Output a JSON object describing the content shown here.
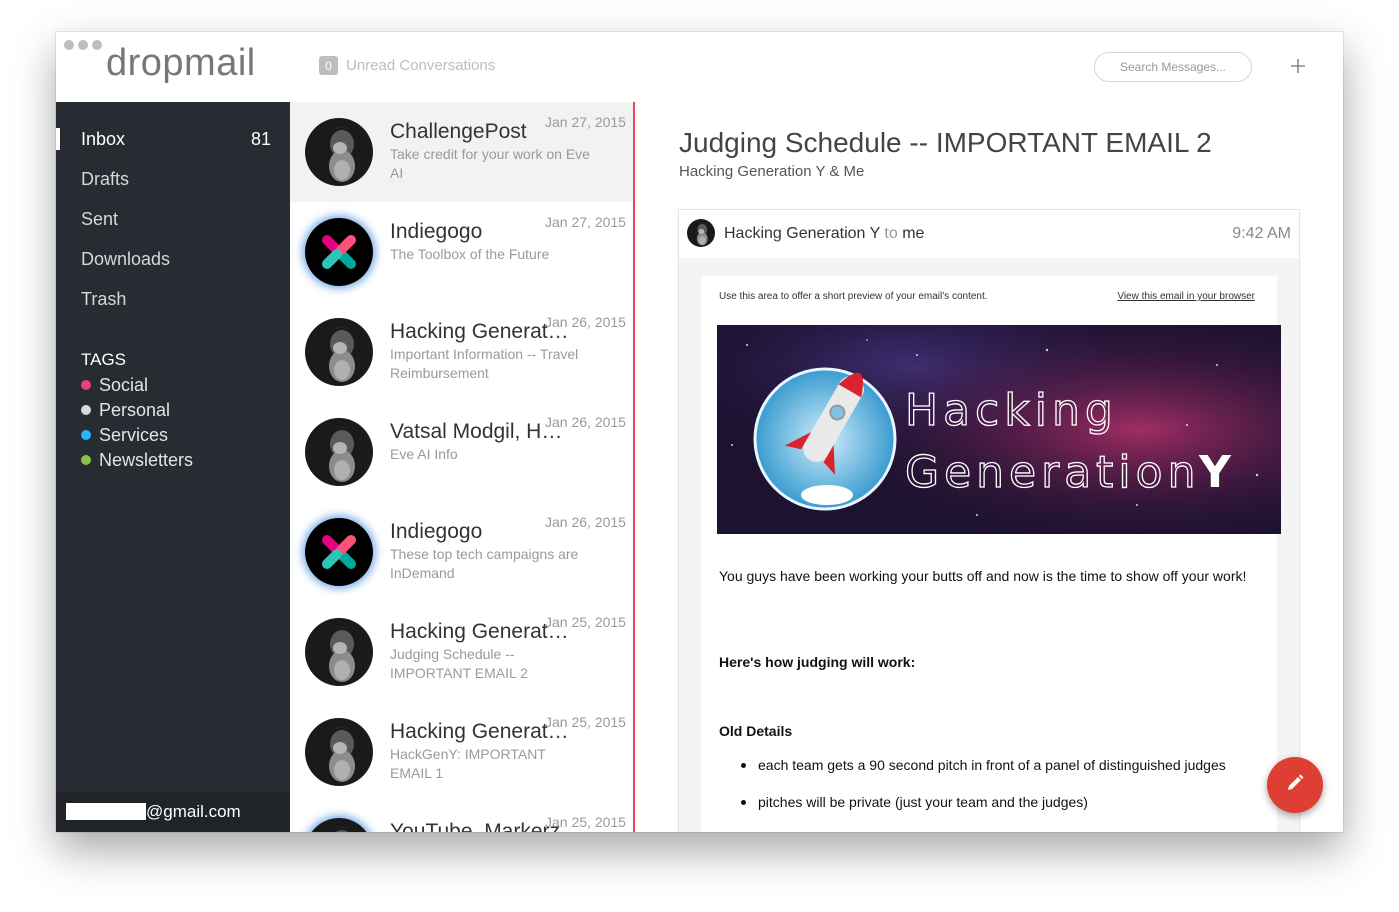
{
  "app": {
    "logo": "dropmail",
    "unread_count": "0",
    "unread_label": "Unread Conversations",
    "search_placeholder": "Search Messages...",
    "add_icon": "plus-icon"
  },
  "sidebar": {
    "items": [
      {
        "label": "Inbox",
        "count": "81",
        "active": true
      },
      {
        "label": "Drafts",
        "count": ""
      },
      {
        "label": "Sent",
        "count": ""
      },
      {
        "label": "Downloads",
        "count": ""
      },
      {
        "label": "Trash",
        "count": ""
      }
    ],
    "tags_title": "TAGS",
    "tags": [
      {
        "label": "Social",
        "color": "#ec407a"
      },
      {
        "label": "Personal",
        "color": "#d9d9d9"
      },
      {
        "label": "Services",
        "color": "#29b6f6"
      },
      {
        "label": "Newsletters",
        "color": "#8bc34a"
      }
    ],
    "account_suffix": "@gmail.com"
  },
  "messages": [
    {
      "from": "ChallengePost",
      "date": "Jan 27, 2015",
      "preview": "Take credit for your work on Eve AI",
      "avatar": "bearded-man-avatar",
      "selected": true
    },
    {
      "from": "Indiegogo",
      "date": "Jan 27, 2015",
      "preview": "The Toolbox of the Future",
      "avatar": "indiegogo-logo"
    },
    {
      "from": "Hacking Generatio...",
      "date": "Jan 26, 2015",
      "preview": "Important Information -- Travel Reimbursement",
      "avatar": "bearded-man-avatar"
    },
    {
      "from": "Vatsal Modgil, Hac...",
      "date": "Jan 26, 2015",
      "preview": "Eve AI Info",
      "avatar": "bearded-man-avatar"
    },
    {
      "from": "Indiegogo",
      "date": "Jan 26, 2015",
      "preview": "These top tech campaigns are InDemand",
      "avatar": "indiegogo-logo"
    },
    {
      "from": "Hacking Generatio...",
      "date": "Jan 25, 2015",
      "preview": "Judging Schedule -- IMPORTANT EMAIL 2",
      "avatar": "bearded-man-avatar"
    },
    {
      "from": "Hacking Generatio...",
      "date": "Jan 25, 2015",
      "preview": "HackGenY: IMPORTANT EMAIL 1",
      "avatar": "bearded-man-avatar"
    },
    {
      "from": "YouTube, Markerz",
      "date": "Jan 25, 2015",
      "preview": "",
      "avatar": "bearded-man-avatar"
    }
  ],
  "reading": {
    "subject": "Judging Schedule -- IMPORTANT EMAIL 2",
    "participants": "Hacking Generation Y & Me",
    "sender": "Hacking Generation Y",
    "to_word": "to",
    "recipient": "me",
    "time": "9:42 AM",
    "preheader": "Use this area to offer a short preview of your email's content.",
    "browser_link": "View this email in your browser",
    "banner_line1": "Hacking",
    "banner_line2": "Generation",
    "banner_y": "Y",
    "paragraph": "You guys have been working your butts off and now is the time to show off your work!",
    "heading": "Here's how judging will work:",
    "subheading": "Old Details",
    "bullets": [
      "each team gets a 90 second pitch in front of a panel of distinguished judges",
      "pitches will be private (just your team and the judges)"
    ]
  },
  "compose_icon": "pencil-icon"
}
